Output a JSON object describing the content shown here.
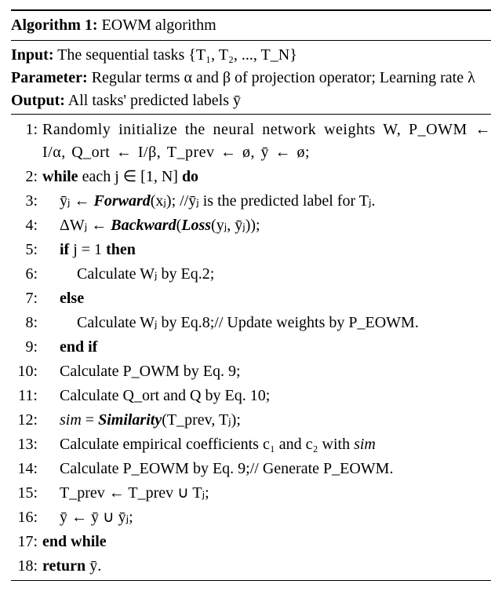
{
  "algo": {
    "title_label": "Algorithm 1:",
    "title_text": " EOWM algorithm",
    "input_label": "Input:",
    "input_text": " The sequential tasks {T₁, T₂, ..., T_N}",
    "parameter_label": "Parameter:",
    "parameter_text": " Regular terms α and β of projection operator; Learning rate λ",
    "output_label": "Output:",
    "output_text": " All tasks' predicted labels ȳ",
    "lines": [
      {
        "n": "1:",
        "indent": 0,
        "pre": "",
        "text": "Randomly initialize the neural network weights W, P_OWM ← I/α, Q_ort ← I/β, T_prev ← ø, ȳ ← ø;",
        "cls": "tightjust"
      },
      {
        "n": "2:",
        "indent": 0,
        "pre": "while ",
        "text": "each j ∈ [1, N] ",
        "post_b": "do"
      },
      {
        "n": "3:",
        "indent": 1,
        "text": "ȳⱼ ← ",
        "bi": "Forward",
        "post": "(xⱼ); //ȳⱼ is the predicted label for Tⱼ."
      },
      {
        "n": "4:",
        "indent": 1,
        "text": "ΔWⱼ ← ",
        "bi": "Backward",
        "post": "(",
        "bi2": "Loss",
        "post2": "(yⱼ, ȳⱼ));"
      },
      {
        "n": "5:",
        "indent": 1,
        "pre": "if ",
        "text": "j = 1 ",
        "post_b": "then"
      },
      {
        "n": "6:",
        "indent": 2,
        "text": "Calculate Wⱼ by Eq.2;"
      },
      {
        "n": "7:",
        "indent": 1,
        "pre": "else",
        "text": ""
      },
      {
        "n": "8:",
        "indent": 2,
        "text": "Calculate Wⱼ by Eq.8;// Update weights by P_EOWM."
      },
      {
        "n": "9:",
        "indent": 1,
        "pre": "end if",
        "text": ""
      },
      {
        "n": "10:",
        "indent": 1,
        "text": "Calculate P_OWM by Eq. 9;"
      },
      {
        "n": "11:",
        "indent": 1,
        "text": "Calculate Q_ort and Q by Eq. 10;"
      },
      {
        "n": "12:",
        "indent": 1,
        "itpre": "sim",
        "text": " = ",
        "bi": "Similarity",
        "post": "(T_prev, Tⱼ);"
      },
      {
        "n": "13:",
        "indent": 1,
        "text": "Calculate empirical coefficients c₁ and c₂ with ",
        "itpost": "sim"
      },
      {
        "n": "14:",
        "indent": 1,
        "text": "Calculate P_EOWM by Eq. 9;// Generate P_EOWM."
      },
      {
        "n": "15:",
        "indent": 1,
        "text": "T_prev ← T_prev ∪ Tⱼ;"
      },
      {
        "n": "16:",
        "indent": 1,
        "text": "ȳ ← ȳ ∪ ȳⱼ;"
      },
      {
        "n": "17:",
        "indent": 0,
        "pre": "end while",
        "text": ""
      },
      {
        "n": "18:",
        "indent": 0,
        "pre": "return ",
        "text": "ȳ."
      }
    ]
  },
  "chart_data": {
    "type": "table",
    "title": "Algorithm 1: EOWM algorithm",
    "inputs": "{T1, T2, ..., TN}",
    "parameters": [
      "alpha",
      "beta",
      "lambda"
    ],
    "output": "y_bar (predicted labels for all tasks)",
    "steps": [
      "Randomly initialize W; P_OWM <- I/alpha; Q_ort <- I/beta; T_prev <- empty; y_bar <- empty",
      "while each j in [1, N] do",
      "  y_bar_j <- Forward(x_j)  // predicted label for T_j",
      "  DeltaW_j <- Backward(Loss(y_j, y_bar_j))",
      "  if j == 1 then",
      "    Calculate W_j by Eq.2",
      "  else",
      "    Calculate W_j by Eq.8  // Update weights by P_EOWM",
      "  end if",
      "  Calculate P_OWM by Eq.9",
      "  Calculate Q_ort and Q by Eq.10",
      "  sim = Similarity(T_prev, T_j)",
      "  Calculate c1 and c2 with sim",
      "  Calculate P_EOWM by Eq.9  // Generate P_EOWM",
      "  T_prev <- T_prev union T_j",
      "  y_bar <- y_bar union y_bar_j",
      "end while",
      "return y_bar"
    ]
  }
}
